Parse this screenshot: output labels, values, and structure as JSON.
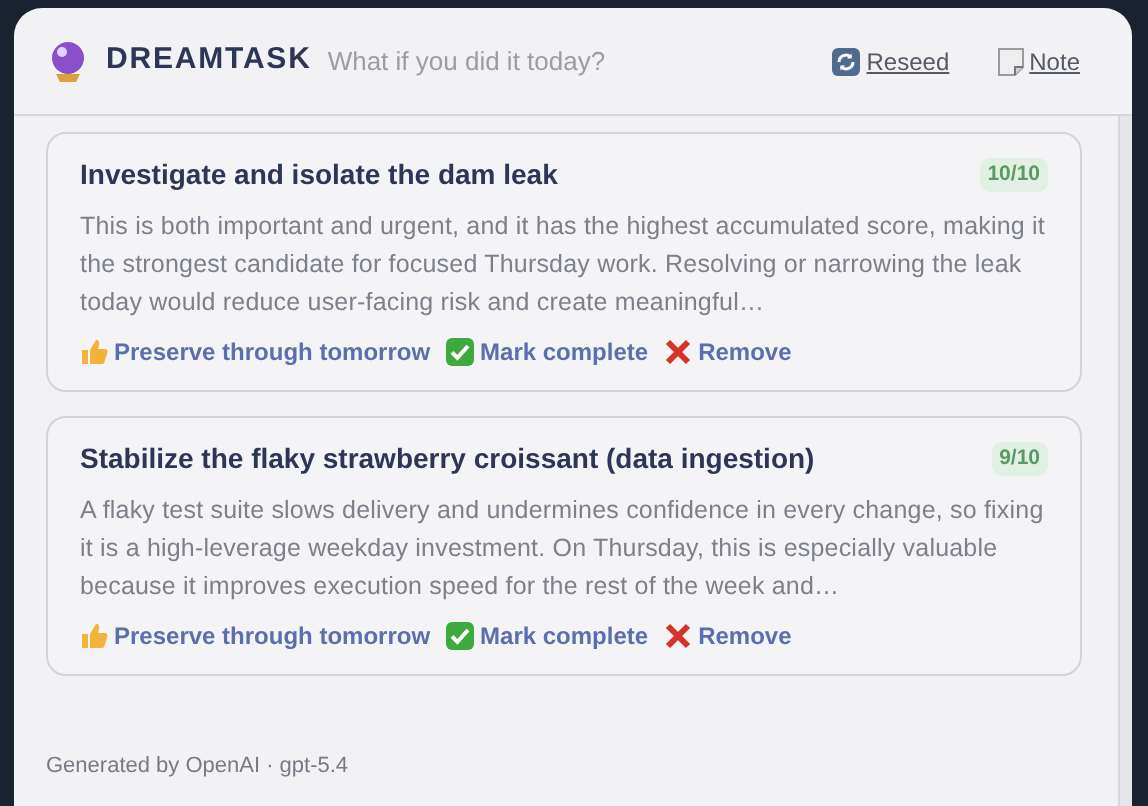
{
  "header": {
    "app_name": "DREAMTASK",
    "tagline": "What if you did it today?",
    "links": [
      {
        "kind": "reseed",
        "label": "Reseed"
      },
      {
        "kind": "note",
        "label": "Note"
      }
    ]
  },
  "tasks": [
    {
      "title": "Investigate and isolate the dam leak",
      "score": "10/10",
      "description": "This is both important and urgent, and it has the highest accumulated score, making it the strongest candidate for focused Thursday work. Resolving or narrowing the leak today would reduce user-facing risk and create meaningful…",
      "actions": [
        {
          "kind": "preserve",
          "label": "Preserve through tomorrow"
        },
        {
          "kind": "complete",
          "label": "Mark complete"
        },
        {
          "kind": "remove",
          "label": "Remove"
        }
      ]
    },
    {
      "title": "Stabilize the flaky strawberry croissant (data ingestion)",
      "score": "9/10",
      "description": "A flaky test suite slows delivery and undermines confidence in every change, so fixing it is a high-leverage weekday investment. On Thursday, this is especially valuable because it improves execution speed for the rest of the week and…",
      "actions": [
        {
          "kind": "preserve",
          "label": "Preserve through tomorrow"
        },
        {
          "kind": "complete",
          "label": "Mark complete"
        },
        {
          "kind": "remove",
          "label": "Remove"
        }
      ]
    }
  ],
  "footer": "Generated by OpenAI · gpt-5.4"
}
